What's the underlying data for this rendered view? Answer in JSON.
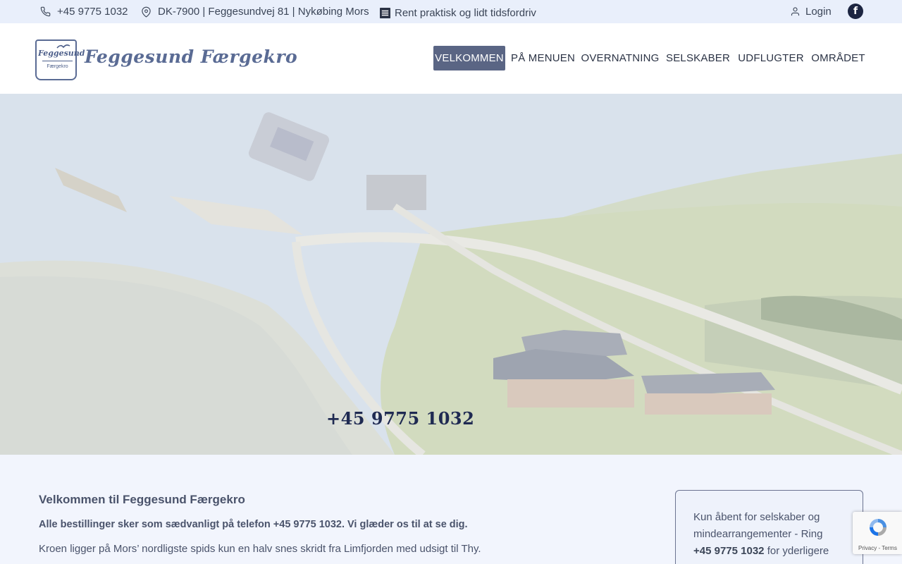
{
  "topbar": {
    "phone": "+45 9775 1032",
    "address": "DK-7900 | Feggesundvej 81 | Nykøbing Mors",
    "tagline": "Rent praktisk og lidt tidsfordriv",
    "login": "Login",
    "facebook": "f"
  },
  "logo": {
    "badge_top": "Feggesund",
    "badge_bottom": "Færgekro",
    "wordmark": "Feggesund Færgekro"
  },
  "nav": {
    "items": [
      "VELKOMMEN",
      "PÅ MENUEN",
      "OVERNATNING",
      "SELSKABER",
      "UDFLUGTER",
      "OMRÅDET"
    ]
  },
  "hero": {
    "phone": "+45 9775 1032"
  },
  "content": {
    "title": "Velkommen til Feggesund Færgekro",
    "bold_line": "Alle bestillinger sker som sædvanligt på telefon +45 9775 1032. Vi glæder os til at se dig.",
    "paragraph": "Kroen ligger på Mors’ nordligste spids kun en halv snes skridt fra Limfjorden med udsigt til Thy."
  },
  "infobox": {
    "text_before": "Kun åbent for selskaber og mindearrangementer - Ring",
    "phone": "+45 9775 1032",
    "text_after": "for yderligere"
  },
  "recaptcha": {
    "terms": "Privacy - Terms"
  },
  "colors": {
    "topbar_bg": "#e9effb",
    "nav_active_bg": "#5a6584",
    "content_bg": "#f2f5fd",
    "facebook_bg": "#1c2541"
  }
}
